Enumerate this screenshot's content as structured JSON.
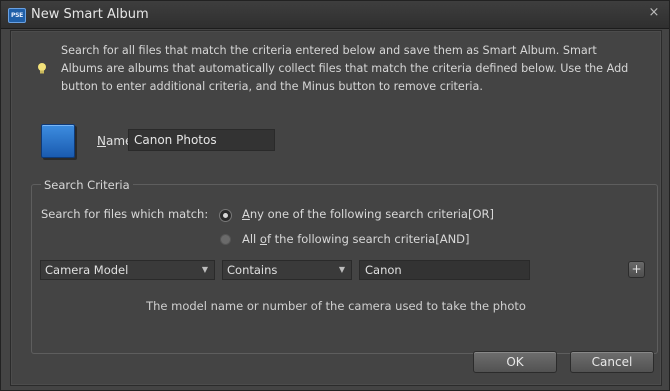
{
  "window": {
    "title": "New Smart Album",
    "app_icon_text": "PSE",
    "close_symbol": "×"
  },
  "info": {
    "text": "Search for all files that match the criteria entered below and save them as Smart Album. Smart Albums are albums that automatically collect files that match the criteria defined below. Use the Add button to enter additional criteria, and the Minus button to remove criteria.",
    "icon": "lightbulb-icon"
  },
  "name_field": {
    "label_hotkey": "N",
    "label_rest": "ame:",
    "value": "Canon Photos"
  },
  "search_criteria": {
    "legend": "Search Criteria",
    "match_label": "Search for files which match:",
    "option_or_hotkey": "A",
    "option_or_rest": "ny one of the following search criteria[OR]",
    "option_and_prefix": "All ",
    "option_and_hotkey": "o",
    "option_and_rest": "f the following search criteria[AND]",
    "selected": "OR",
    "rule": {
      "field": "Camera Model",
      "operator": "Contains",
      "value": "Canon",
      "add_symbol": "+"
    },
    "hint": "The model name or number of the camera used to take the photo"
  },
  "buttons": {
    "ok": "OK",
    "cancel": "Cancel"
  },
  "colors": {
    "dialog_bg": "#444444",
    "title_bg": "#2f2f2f",
    "album_icon": "#2a78d0",
    "bulb": "#f3e27a"
  }
}
